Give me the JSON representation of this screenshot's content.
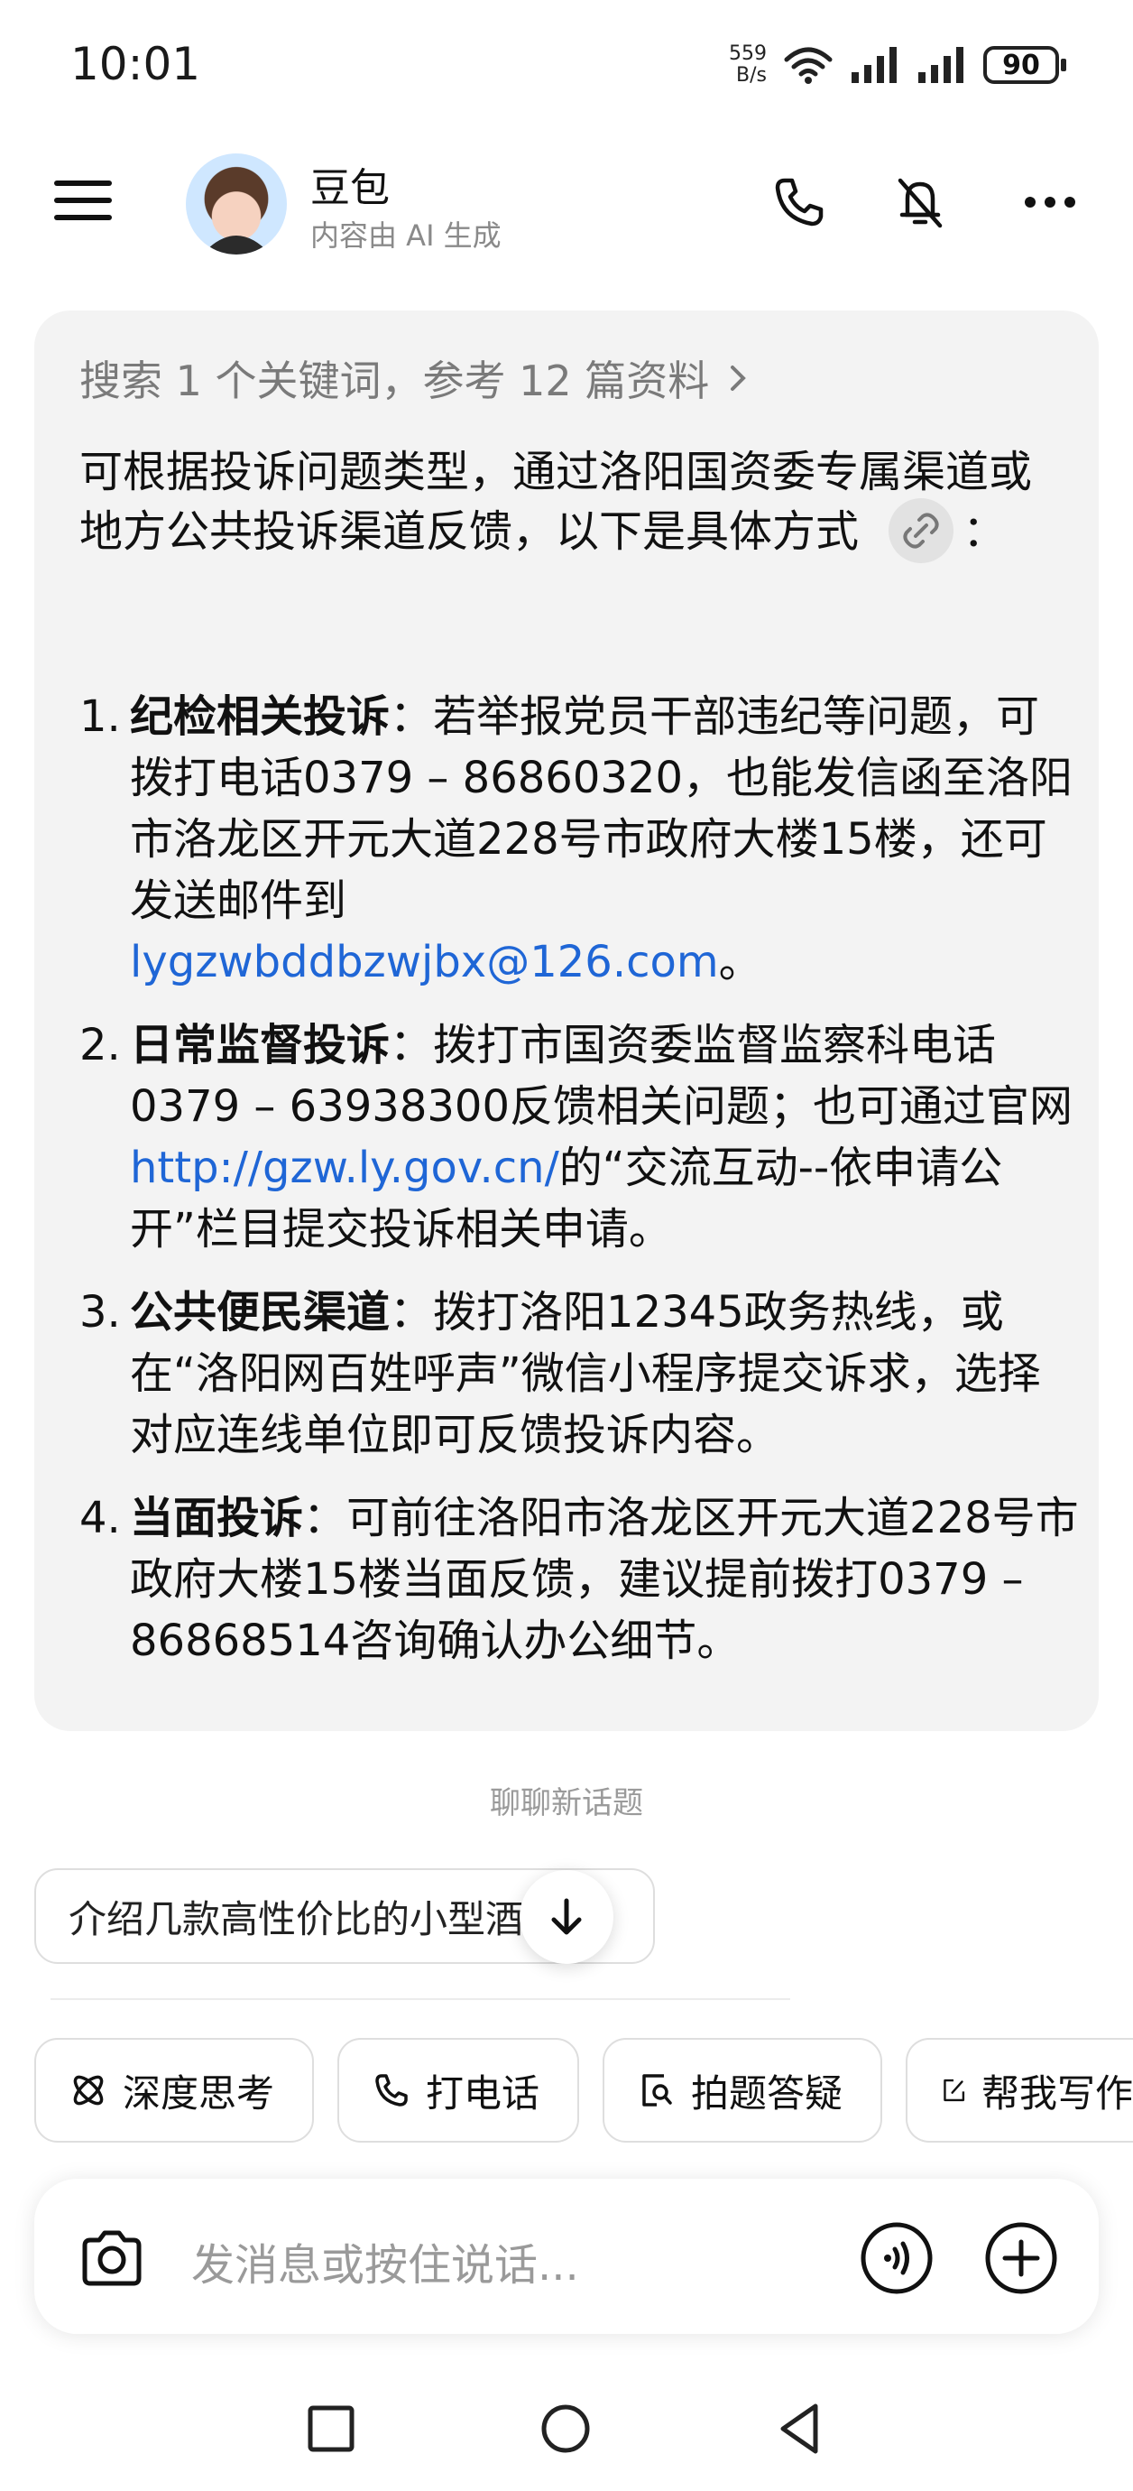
{
  "status_bar": {
    "time": "10:01",
    "net_speed_value": "559",
    "net_speed_unit": "B/s",
    "battery": "90",
    "icons": [
      "wifi-icon",
      "signal-icon",
      "signal-icon",
      "battery-icon"
    ]
  },
  "header": {
    "bot_name": "豆包",
    "bot_subtitle": "内容由 AI 生成",
    "icons": [
      "menu-icon",
      "avatar",
      "phone-icon",
      "mute-icon",
      "more-icon"
    ]
  },
  "answer": {
    "search_ref": "搜索 1 个关键词，参考 12 篇资料",
    "intro": "可根据投诉问题类型，通过洛阳国资委专属渠道或地方公共投诉渠道反馈，以下是具体方式",
    "intro_colon": "：",
    "items": [
      {
        "num": "1.",
        "title": "纪检相关投诉",
        "sep": "：",
        "text_before": "若举报党员干部违纪等问题，可拨打电话0379 – 86860320，也能发信函至洛阳市洛龙区开元大道228号市政府大楼15楼，还可发送邮件到",
        "link": "lygzwbddbzwjbx@126.com",
        "text_after": "。"
      },
      {
        "num": "2.",
        "title": "日常监督投诉",
        "sep": "：",
        "text_before": "拨打市国资委监督监察科电话0379 – 63938300反馈相关问题；也可通过官网",
        "link": "http://gzw.ly.gov.cn/",
        "text_after": "的“交流互动--依申请公开”栏目提交投诉相关申请。"
      },
      {
        "num": "3.",
        "title": "公共便民渠道",
        "sep": "：",
        "text_before": "拨打洛阳12345政务热线，或在“洛阳网百姓呼声”微信小程序提交诉求，选择对应连线单位即可反馈投诉内容。",
        "link": "",
        "text_after": ""
      },
      {
        "num": "4.",
        "title": "当面投诉",
        "sep": "：",
        "text_before": "可前往洛阳市洛龙区开元大道228号市政府大楼15楼当面反馈，建议提前拨打0379 – 86868514咨询确认办公细节。",
        "link": "",
        "text_after": ""
      }
    ]
  },
  "suggestions": {
    "label": "聊聊新话题",
    "item": "介绍几款高性价比的小型酒…"
  },
  "chips": [
    "深度思考",
    "打电话",
    "拍题答疑",
    "帮我写作"
  ],
  "input": {
    "placeholder": "发消息或按住说话..."
  },
  "colors": {
    "card_bg": "#f3f3f3",
    "link": "#1f66d6",
    "muted": "#9a9a9a"
  }
}
